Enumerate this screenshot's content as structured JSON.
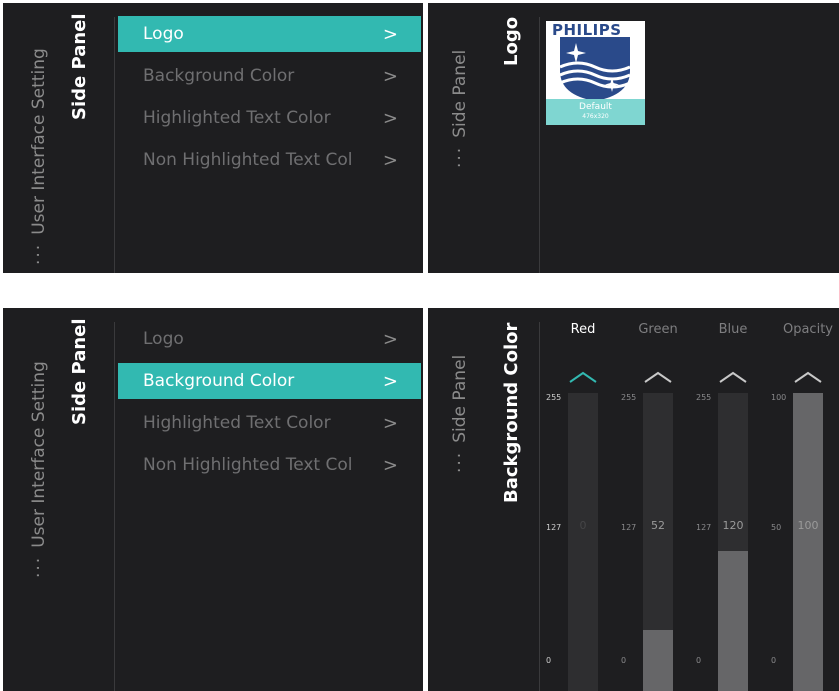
{
  "top_left": {
    "breadcrumb_dots": "···",
    "breadcrumb": "User Interface Setting",
    "heading": "Side Panel",
    "items": [
      {
        "label": "Logo",
        "chevron": ">"
      },
      {
        "label": "Background Color",
        "chevron": ">"
      },
      {
        "label": "Highlighted Text Color",
        "chevron": ">"
      },
      {
        "label": "Non Highlighted Text Col",
        "chevron": ">"
      }
    ],
    "selected_index": 0
  },
  "top_right": {
    "breadcrumb_dots": "···",
    "breadcrumb": "Side Panel",
    "heading": "Logo",
    "logo": {
      "brand": "PHILIPS",
      "label": "Default",
      "size": "476x320",
      "icon": "philips-shield-icon"
    }
  },
  "bottom_left": {
    "breadcrumb_dots": "···",
    "breadcrumb": "User Interface Setting",
    "heading": "Side Panel",
    "items": [
      {
        "label": "Logo",
        "chevron": ">"
      },
      {
        "label": "Background Color",
        "chevron": ">"
      },
      {
        "label": "Highlighted Text Color",
        "chevron": ">"
      },
      {
        "label": "Non Highlighted Text Col",
        "chevron": ">"
      }
    ],
    "selected_index": 1
  },
  "bottom_right": {
    "breadcrumb_dots": "···",
    "breadcrumb": "Side Panel",
    "heading": "Background Color",
    "channels": [
      {
        "label": "Red",
        "max": "255",
        "mid": "127",
        "min": "0",
        "value": "0",
        "level": 0,
        "active": true
      },
      {
        "label": "Green",
        "max": "255",
        "mid": "127",
        "min": "0",
        "value": "52",
        "level": 0.204,
        "active": false
      },
      {
        "label": "Blue",
        "max": "255",
        "mid": "127",
        "min": "0",
        "value": "120",
        "level": 0.471,
        "active": false
      },
      {
        "label": "Opacity",
        "max": "100",
        "mid": "50",
        "min": "0",
        "value": "100",
        "level": 1.0,
        "active": false
      }
    ],
    "colors": {
      "accent": "#32b9b1",
      "fill": "#666668",
      "track": "#2e2e30"
    }
  }
}
